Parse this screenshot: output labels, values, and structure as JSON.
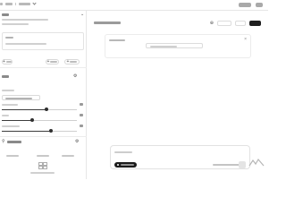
{
  "header": {
    "breadcrumb_1": "",
    "breadcrumb_2": "",
    "actions": [
      "",
      ""
    ]
  },
  "system_section": {
    "title": "",
    "description": "",
    "role_label": "",
    "content": "",
    "buttons": [
      "",
      ""
    ]
  },
  "model_section": {
    "title": "",
    "selected_model": "",
    "sliders": [
      {
        "label": "",
        "value": "",
        "level": 0.6
      },
      {
        "label": "",
        "value": "",
        "level": 0.4
      },
      {
        "label": "",
        "value": "",
        "level": 0.65
      }
    ]
  },
  "mcp_section": {
    "title": "",
    "counts": [
      {
        "value": "",
        "label": ""
      },
      {
        "value": "",
        "label": ""
      },
      {
        "value": "",
        "label": ""
      }
    ],
    "empty_text": ""
  },
  "chat": {
    "title": "",
    "toolbar": [
      "",
      "",
      ""
    ],
    "message": {
      "role": "",
      "placeholder": ""
    },
    "composer": {
      "placeholder": "",
      "add_button": "",
      "hint": ""
    }
  },
  "colors": {
    "accent": "#1f1f1f",
    "border": "#e6e6e6",
    "muted": "#bdbdbd"
  }
}
